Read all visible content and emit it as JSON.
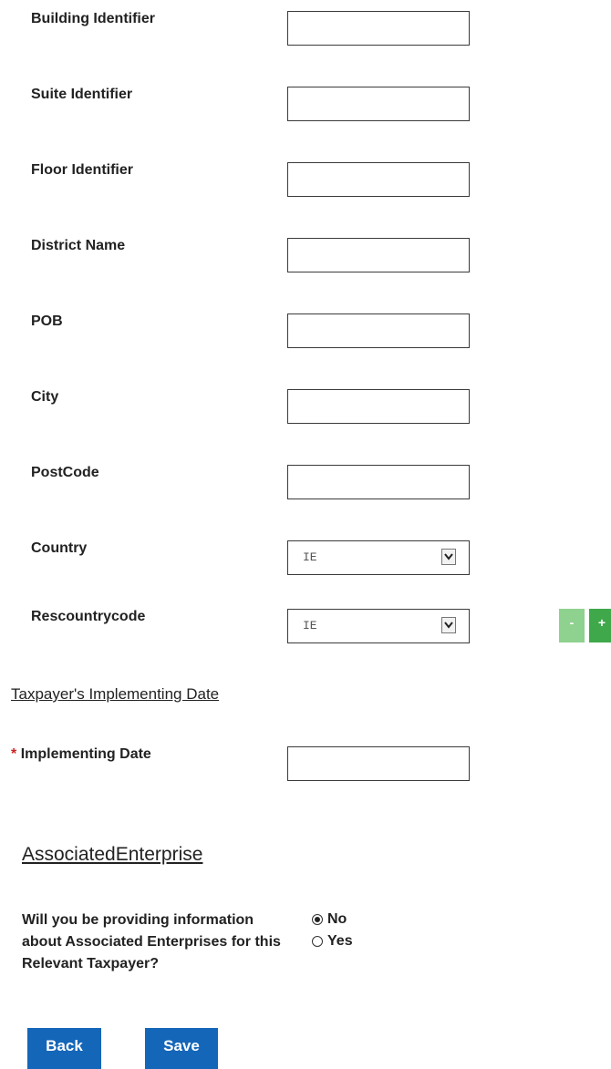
{
  "address_fields": [
    {
      "label": "Building Identifier",
      "value": ""
    },
    {
      "label": "Suite Identifier",
      "value": ""
    },
    {
      "label": "Floor Identifier",
      "value": ""
    },
    {
      "label": "District Name",
      "value": ""
    },
    {
      "label": "POB",
      "value": ""
    },
    {
      "label": "City",
      "value": ""
    },
    {
      "label": "PostCode",
      "value": ""
    }
  ],
  "country": {
    "label": "Country",
    "value": "IE"
  },
  "rescountrycode": {
    "label": "Rescountrycode",
    "value": "IE"
  },
  "stepper": {
    "minus": "-",
    "plus": "+"
  },
  "implementing_section": {
    "title": "Taxpayer's Implementing Date",
    "required_marker": "*",
    "field_label": "Implementing Date",
    "value": ""
  },
  "associated_section": {
    "title": "AssociatedEnterprise",
    "question": "Will you be providing information about Associated Enterprises for this Relevant Taxpayer?",
    "options": [
      {
        "label": "No",
        "selected": true
      },
      {
        "label": "Yes",
        "selected": false
      }
    ]
  },
  "actions": {
    "back": "Back",
    "save": "Save"
  },
  "colors": {
    "button": "#1466b8",
    "stepper_plus": "#3fa84a",
    "stepper_minus": "#8fd18f",
    "required": "#cc2222"
  }
}
